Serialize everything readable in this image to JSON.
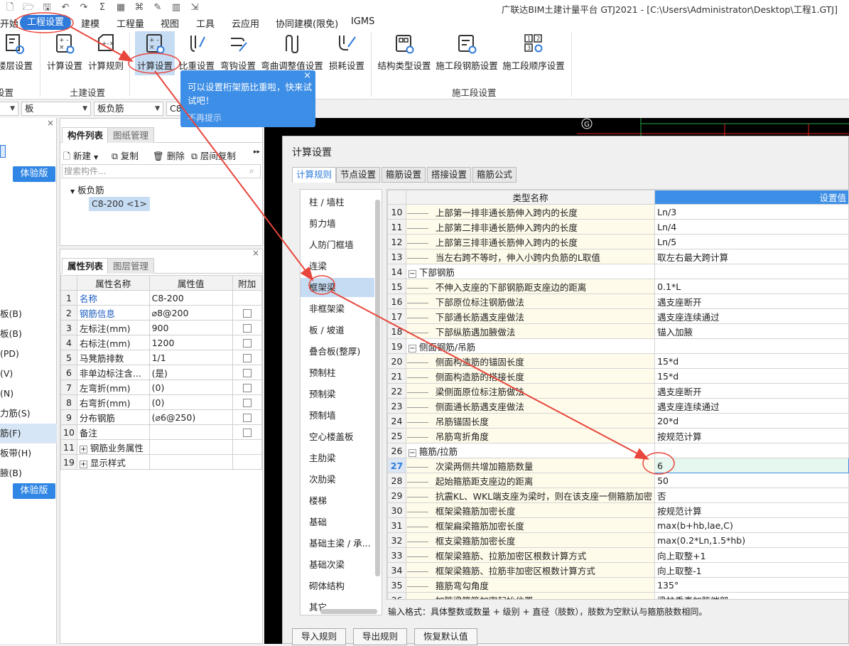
{
  "window": {
    "title": "广联达BIM土建计量平台 GTJ2021 - [C:\\Users\\Administrator\\Desktop\\工程1.GTJ]"
  },
  "menu": [
    "开始",
    "工程设置",
    "建模",
    "工程量",
    "视图",
    "工具",
    "云应用",
    "协同建模(限免)",
    "IGMS"
  ],
  "ribbon": {
    "buttons": [
      "楼层设置",
      "计算设置",
      "计算规则",
      "计算设置",
      "比重设置",
      "弯钩设置",
      "弯曲调整值设置",
      "损耗设置",
      "结构类型设置",
      "施工段钢筋设置",
      "施工段顺序设置"
    ],
    "groups": [
      "设置",
      "土建设置",
      "施工段设置"
    ]
  },
  "selectors": [
    "板",
    "板负筋",
    "C8"
  ],
  "tooltip": {
    "text": "可以设置桁架筋比重啦，快来试试吧！",
    "dismiss": "不再提示",
    "close": "×"
  },
  "left_panel": {
    "trial_label": "体验版",
    "items": [
      "板(B)",
      "板(B)",
      "(PD)",
      "(V)",
      "(N)",
      "力筋(S)",
      "筋(F)",
      "板带(H)",
      "腋(B)"
    ]
  },
  "component_panel": {
    "tabs": [
      "构件列表",
      "图纸管理"
    ],
    "toolbar": [
      "新建",
      "复制",
      "删除",
      "层间复制"
    ],
    "search_placeholder": "搜索构件...",
    "tree_root": "板负筋",
    "tree_child": "C8-200 <1>"
  },
  "property_panel": {
    "tabs": [
      "属性列表",
      "图层管理"
    ],
    "headers": [
      "",
      "属性名称",
      "属性值",
      "附加"
    ],
    "rows": [
      {
        "no": "1",
        "name": "名称",
        "value": "C8-200",
        "blue": true,
        "check": false
      },
      {
        "no": "2",
        "name": "钢筋信息",
        "value": "⌀8@200",
        "blue": true,
        "check": true
      },
      {
        "no": "3",
        "name": "左标注(mm)",
        "value": "900",
        "blue": false,
        "check": true
      },
      {
        "no": "4",
        "name": "右标注(mm)",
        "value": "1200",
        "blue": false,
        "check": true
      },
      {
        "no": "5",
        "name": "马凳筋排数",
        "value": "1/1",
        "blue": false,
        "check": true
      },
      {
        "no": "6",
        "name": "非单边标注含...",
        "value": "(是)",
        "blue": false,
        "check": true
      },
      {
        "no": "7",
        "name": "左弯折(mm)",
        "value": "(0)",
        "blue": false,
        "check": true
      },
      {
        "no": "8",
        "name": "右弯折(mm)",
        "value": "(0)",
        "blue": false,
        "check": true
      },
      {
        "no": "9",
        "name": "分布钢筋",
        "value": "(⌀6@250)",
        "blue": false,
        "check": true
      },
      {
        "no": "10",
        "name": "备注",
        "value": "",
        "blue": false,
        "check": true
      },
      {
        "no": "11",
        "name": "钢筋业务属性",
        "value": "",
        "blue": false,
        "check": false,
        "expand": true
      },
      {
        "no": "19",
        "name": "显示样式",
        "value": "",
        "blue": false,
        "check": false,
        "expand": true
      }
    ]
  },
  "dialog": {
    "title": "计算设置",
    "tabs": [
      "计算规则",
      "节点设置",
      "箍筋设置",
      "搭接设置",
      "箍筋公式"
    ],
    "categories": [
      "柱 / 墙柱",
      "剪力墙",
      "人防门框墙",
      "连梁",
      "框架梁",
      "非框架梁",
      "板 / 坡道",
      "叠合板(整厚)",
      "预制柱",
      "预制梁",
      "预制墙",
      "空心楼盖板",
      "主肋梁",
      "次肋梁",
      "楼梯",
      "基础",
      "基础主梁 / 承...",
      "基础次梁",
      "砌体结构",
      "其它"
    ],
    "selected_category": "框架梁",
    "grid_headers": [
      "",
      "类型名称",
      "设置值"
    ],
    "rows": [
      {
        "no": "10",
        "name": "上部第一排非通长筋伸入跨内的长度",
        "value": "Ln/3"
      },
      {
        "no": "11",
        "name": "上部第二排非通长筋伸入跨内的长度",
        "value": "Ln/4"
      },
      {
        "no": "12",
        "name": "上部第三排非通长筋伸入跨内的长度",
        "value": "Ln/5"
      },
      {
        "no": "13",
        "name": "当左右跨不等时，伸入小跨内负筋的L取值",
        "value": "取左右最大跨计算"
      },
      {
        "no": "14",
        "name": "下部钢筋",
        "value": "",
        "group": true
      },
      {
        "no": "15",
        "name": "不伸入支座的下部钢筋距支座边的距离",
        "value": "0.1*L"
      },
      {
        "no": "16",
        "name": "下部原位标注钢筋做法",
        "value": "遇支座断开"
      },
      {
        "no": "17",
        "name": "下部通长筋遇支座做法",
        "value": "遇支座连续通过"
      },
      {
        "no": "18",
        "name": "下部纵筋遇加腋做法",
        "value": "锚入加腋"
      },
      {
        "no": "19",
        "name": "侧面钢筋/吊筋",
        "value": "",
        "group": true
      },
      {
        "no": "20",
        "name": "侧面构造筋的锚固长度",
        "value": "15*d"
      },
      {
        "no": "21",
        "name": "侧面构造筋的搭接长度",
        "value": "15*d"
      },
      {
        "no": "22",
        "name": "梁侧面原位标注筋做法",
        "value": "遇支座断开"
      },
      {
        "no": "23",
        "name": "侧面通长筋遇支座做法",
        "value": "遇支座连续通过"
      },
      {
        "no": "24",
        "name": "吊筋锚固长度",
        "value": "20*d"
      },
      {
        "no": "25",
        "name": "吊筋弯折角度",
        "value": "按规范计算"
      },
      {
        "no": "26",
        "name": "箍筋/拉筋",
        "value": "",
        "group": true
      },
      {
        "no": "27",
        "name": "次梁两侧共增加箍筋数量",
        "value": "6",
        "current": true
      },
      {
        "no": "28",
        "name": "起始箍筋距支座边的距离",
        "value": "50"
      },
      {
        "no": "29",
        "name": "抗震KL、WKL端支座为梁时，则在该支座一侧箍筋加密",
        "value": "否"
      },
      {
        "no": "30",
        "name": "框架梁箍筋加密长度",
        "value": "按规范计算"
      },
      {
        "no": "31",
        "name": "框架扁梁箍筋加密长度",
        "value": "max(b+hb,lae,C)"
      },
      {
        "no": "32",
        "name": "框支梁箍筋加密长度",
        "value": "max(0.2*Ln,1.5*hb)"
      },
      {
        "no": "33",
        "name": "框架梁箍筋、拉筋加密区根数计算方式",
        "value": "向上取整+1"
      },
      {
        "no": "34",
        "name": "框架梁箍筋、拉筋非加密区根数计算方式",
        "value": "向上取整-1"
      },
      {
        "no": "35",
        "name": "箍筋弯勾角度",
        "value": "135°"
      },
      {
        "no": "36",
        "name": "加腋梁箍筋加密起始位置",
        "value": "梁柱垂直加腋端部"
      }
    ],
    "hint": "输入格式：具体整数或数量 + 级别 + 直径（肢数），肢数为空默认与箍筋肢数相同。",
    "buttons": [
      "导入规则",
      "导出规则",
      "恢复默认值"
    ]
  },
  "canvas": {
    "axis_label": "G"
  },
  "colors": {
    "accent": "#2f7bdb",
    "annotation": "#e8463c",
    "grid_line": "#2aa84a",
    "red_line": "#e02020"
  }
}
